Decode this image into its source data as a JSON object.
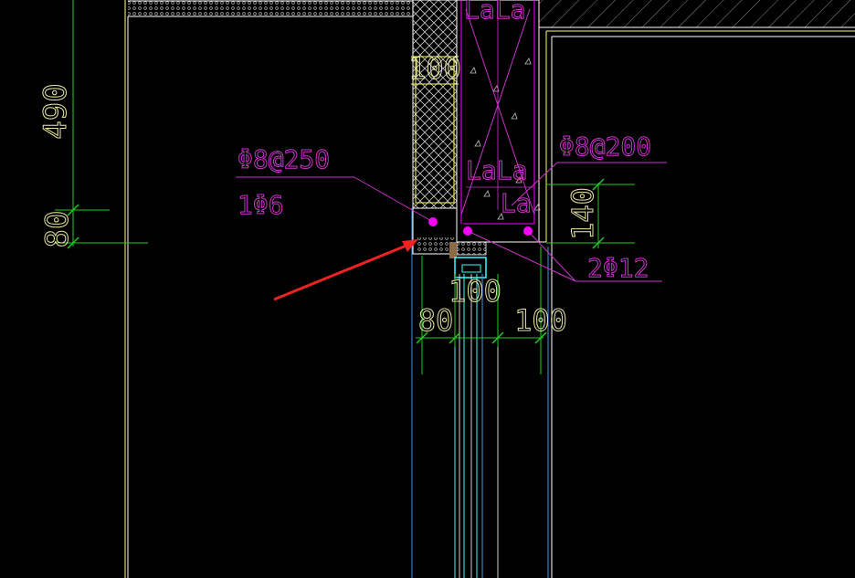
{
  "colors": {
    "background": "#000000",
    "dimension": "#22cc22",
    "dimension_text": "#e8e8a0",
    "annotation": "#cc33cc",
    "structure": "#ffffff",
    "insulation": "#ffff66",
    "frame": "#3399ff",
    "glazing": "#33ffff",
    "rebar": "#ff00ff",
    "hatch": "#c0c0c0",
    "arrow": "#ee2222",
    "reference_line": "#ffff99"
  },
  "dimensions": {
    "left_upper": "490",
    "left_lower": "80",
    "insulation_thickness": "100",
    "beam_height": "140",
    "window_width": "100",
    "bottom_left": "80",
    "bottom_right": "100"
  },
  "annotations": {
    "stirrup_left": "Φ8@250",
    "bar_single": "1Φ6",
    "stirrup_right": "Φ8@200",
    "main_bars": "2Φ12"
  },
  "lap_labels": {
    "top": "LaLa",
    "middle": "LaLa",
    "lower": "La"
  }
}
